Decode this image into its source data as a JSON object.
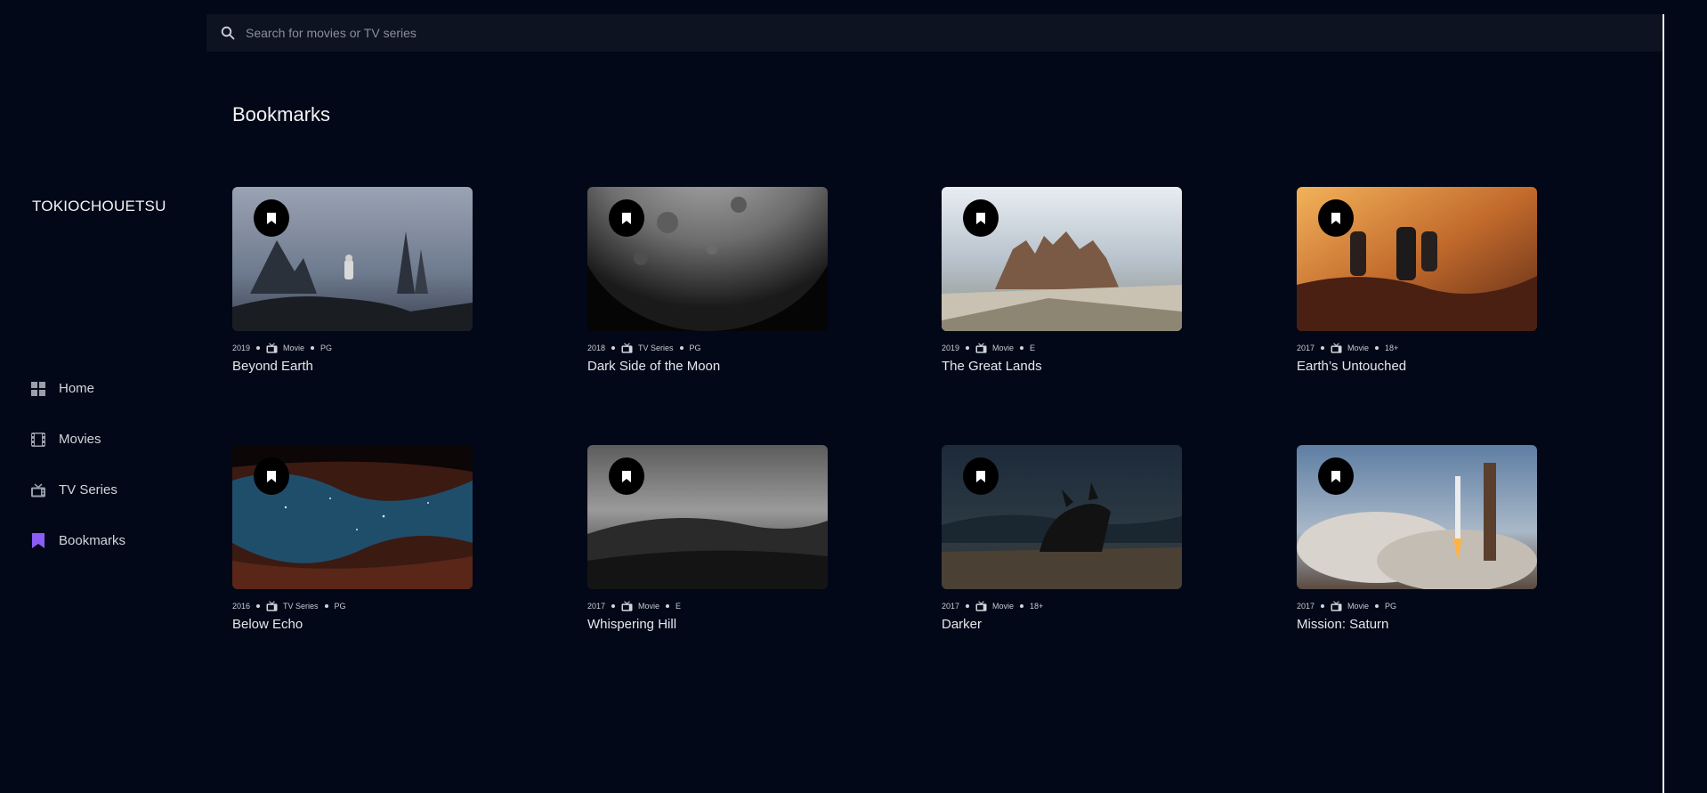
{
  "app": {
    "brand": "TOKIOCHOUETSU"
  },
  "search": {
    "placeholder": "Search for movies or TV series"
  },
  "nav": [
    {
      "label": "Home",
      "icon": "grid-icon"
    },
    {
      "label": "Movies",
      "icon": "film-icon"
    },
    {
      "label": "TV Series",
      "icon": "tv-icon"
    },
    {
      "label": "Bookmarks",
      "icon": "bookmark-icon",
      "active": true
    }
  ],
  "page": {
    "title": "Bookmarks"
  },
  "colors": {
    "accent": "#8b5cf6",
    "background": "#020817",
    "text": "#e5e7eb"
  },
  "cards": [
    {
      "year": "2019",
      "type": "Movie",
      "rating": "PG",
      "title": "Beyond Earth",
      "scene": "rocky-coast"
    },
    {
      "year": "2018",
      "type": "TV Series",
      "rating": "PG",
      "title": "Dark Side of the Moon",
      "scene": "moon"
    },
    {
      "year": "2019",
      "type": "Movie",
      "rating": "E",
      "title": "The Great Lands",
      "scene": "mountains"
    },
    {
      "year": "2017",
      "type": "Movie",
      "rating": "18+",
      "title": "Earth’s Untouched",
      "scene": "sunset-people"
    },
    {
      "year": "2016",
      "type": "TV Series",
      "rating": "PG",
      "title": "Below Echo",
      "scene": "canyon-stars"
    },
    {
      "year": "2017",
      "type": "Movie",
      "rating": "E",
      "title": "Whispering Hill",
      "scene": "foggy-hill"
    },
    {
      "year": "2017",
      "type": "Movie",
      "rating": "18+",
      "title": "Darker",
      "scene": "dark-creature"
    },
    {
      "year": "2017",
      "type": "Movie",
      "rating": "PG",
      "title": "Mission: Saturn",
      "scene": "rocket-launch"
    }
  ]
}
